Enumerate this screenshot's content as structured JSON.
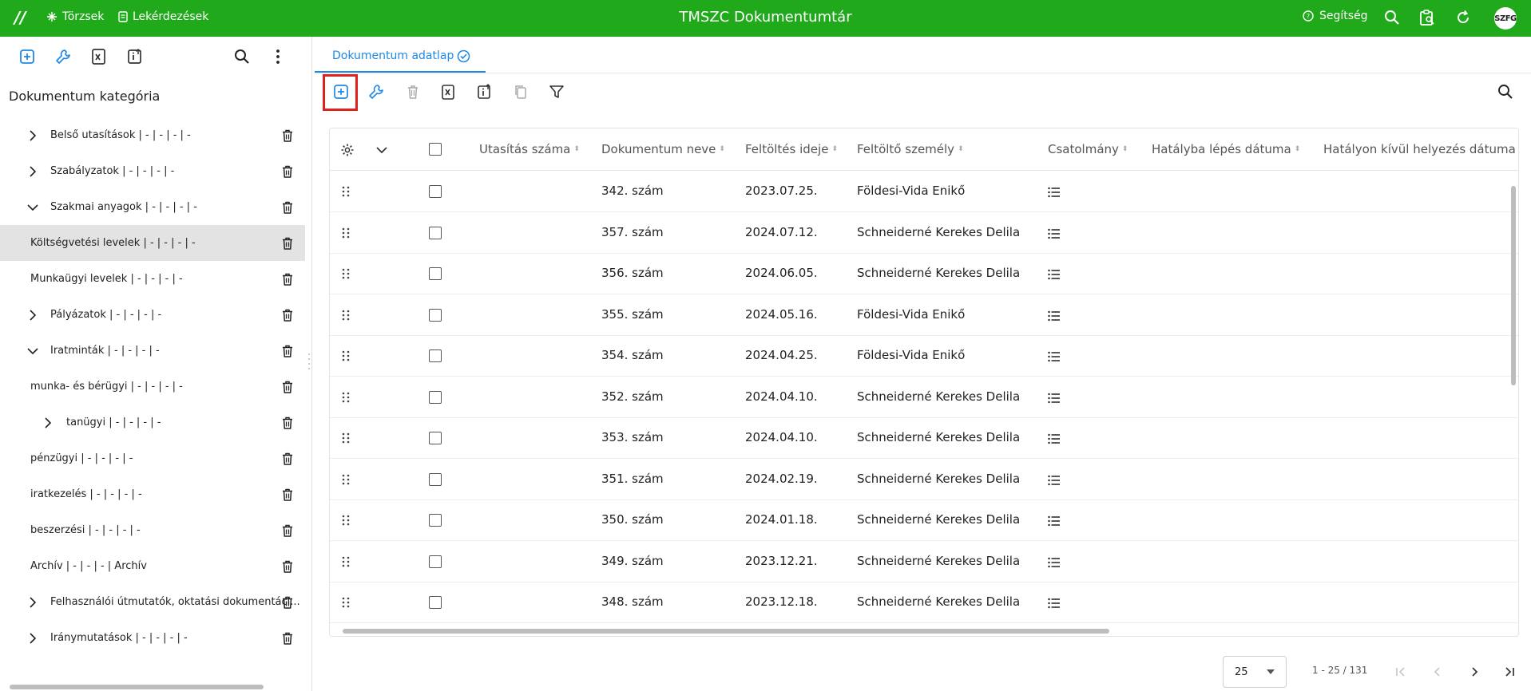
{
  "topbar": {
    "logo": "//",
    "nav_torzsek": "Törzsek",
    "nav_lekerdezesek": "Lekérdezések",
    "title": "TMSZC Dokumentumtár",
    "help": "Segítség",
    "avatar": "SZFG",
    "color": "#21a91c"
  },
  "left_panel": {
    "title": "Dokumentum kategória",
    "tree": [
      {
        "label": "Belső utasítások | - | - | - | -",
        "expander": "collapsed",
        "indent": 1
      },
      {
        "label": "Szabályzatok | - | - | - | -",
        "expander": "collapsed",
        "indent": 1
      },
      {
        "label": "Szakmai anyagok | - | - | - | -",
        "expander": "expanded",
        "indent": 1
      },
      {
        "label": "Költségvetési levelek | - | - | - | -",
        "expander": "none",
        "indent": 0,
        "selected": true
      },
      {
        "label": "Munkaügyi levelek | - | - | - | -",
        "expander": "none",
        "indent": 0
      },
      {
        "label": "Pályázatok | - | - | - | -",
        "expander": "collapsed",
        "indent": 1
      },
      {
        "label": "Iratminták | - | - | - | -",
        "expander": "expanded",
        "indent": 1
      },
      {
        "label": "munka- és bérügyi  | - | - | - | -",
        "expander": "none",
        "indent": 0
      },
      {
        "label": "tanügyi | - | - | - | -",
        "expander": "collapsed",
        "indent": 2
      },
      {
        "label": "pénzügyi | - | - | - | -",
        "expander": "none",
        "indent": 0
      },
      {
        "label": "iratkezelés  | - | - | - | -",
        "expander": "none",
        "indent": 0
      },
      {
        "label": "beszerzési | - | - | - | -",
        "expander": "none",
        "indent": 0
      },
      {
        "label": "Archív | - | - | - | Archív",
        "expander": "none",
        "indent": 0
      },
      {
        "label": "Felhasználói útmutatók, oktatási dokumentáci...",
        "expander": "collapsed",
        "indent": 1
      },
      {
        "label": "Iránymutatások | - | - | - | -",
        "expander": "collapsed",
        "indent": 1
      }
    ]
  },
  "tab": {
    "label": "Dokumentum adatlap"
  },
  "grid": {
    "columns": [
      "Utasítás száma",
      "Dokumentum neve",
      "Feltöltés ideje",
      "Feltöltő személy",
      "Csatolmány",
      "Hatályba lépés dátuma",
      "Hatályon kívül helyezés dátuma"
    ],
    "rows": [
      {
        "nev": "342. szám",
        "ido": "2023.07.25.",
        "szemely": "Földesi-Vida Enikő"
      },
      {
        "nev": "357. szám",
        "ido": "2024.07.12.",
        "szemely": "Schneiderné Kerekes Delila"
      },
      {
        "nev": "356. szám",
        "ido": "2024.06.05.",
        "szemely": "Schneiderné Kerekes Delila"
      },
      {
        "nev": "355. szám",
        "ido": "2024.05.16.",
        "szemely": "Földesi-Vida Enikő"
      },
      {
        "nev": "354. szám",
        "ido": "2024.04.25.",
        "szemely": "Földesi-Vida Enikő"
      },
      {
        "nev": "352. szám",
        "ido": "2024.04.10.",
        "szemely": "Schneiderné Kerekes Delila"
      },
      {
        "nev": "353. szám",
        "ido": "2024.04.10.",
        "szemely": "Schneiderné Kerekes Delila"
      },
      {
        "nev": "351. szám",
        "ido": "2024.02.19.",
        "szemely": "Schneiderné Kerekes Delila"
      },
      {
        "nev": "350. szám",
        "ido": "2024.01.18.",
        "szemely": "Schneiderné Kerekes Delila"
      },
      {
        "nev": "349. szám",
        "ido": "2023.12.21.",
        "szemely": "Schneiderné Kerekes Delila"
      },
      {
        "nev": "348. szám",
        "ido": "2023.12.18.",
        "szemely": "Schneiderné Kerekes Delila"
      }
    ]
  },
  "pagination": {
    "page_size": "25",
    "info": "1 - 25 / 131"
  },
  "colors": {
    "accent": "#1e88e5",
    "highlight": "#e0201c"
  }
}
